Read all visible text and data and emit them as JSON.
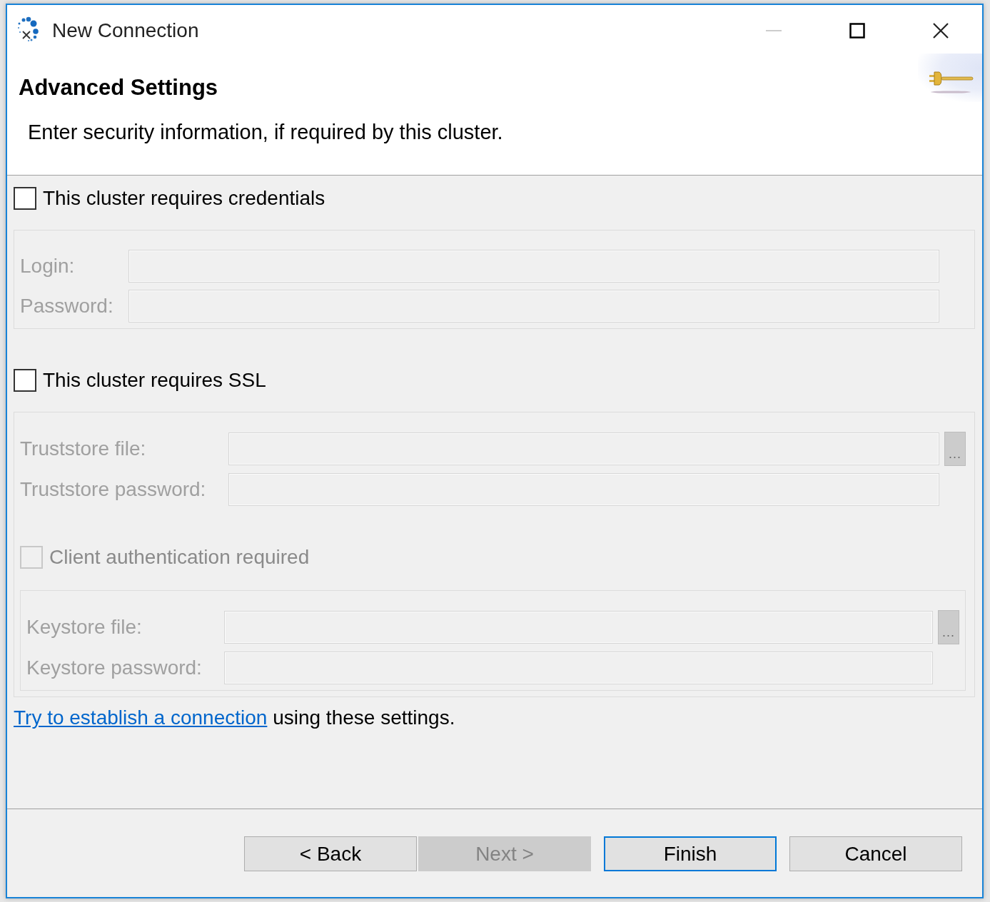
{
  "window": {
    "title": "New Connection",
    "minimize_disabled": true
  },
  "header": {
    "title": "Advanced Settings",
    "description": "Enter security information, if required by this cluster."
  },
  "credentials": {
    "label": "This cluster requires credentials",
    "checked": false,
    "fields": [
      {
        "label": "Login:",
        "disabled": true
      },
      {
        "label": "Password:",
        "disabled": true
      }
    ]
  },
  "ssl": {
    "label": "This cluster requires SSL",
    "checked": false,
    "fields": [
      {
        "label": "Truststore file:",
        "disabled": true,
        "browse": "..."
      },
      {
        "label": "Truststore password:",
        "disabled": true
      }
    ],
    "client_auth": {
      "label": "Client authentication required",
      "checked": false,
      "disabled": true,
      "fields": [
        {
          "label": "Keystore file:",
          "disabled": true,
          "browse": "..."
        },
        {
          "label": "Keystore password:",
          "disabled": true
        }
      ]
    }
  },
  "test_link": {
    "link": "Try to establish a connection",
    "text": "using these settings."
  },
  "buttons": [
    {
      "label": "< Back",
      "disabled": false,
      "default": false
    },
    {
      "label": "Next >",
      "disabled": true,
      "default": false
    },
    {
      "label": "Finish",
      "disabled": false,
      "default": true
    },
    {
      "label": "Cancel",
      "disabled": false,
      "default": false
    }
  ]
}
